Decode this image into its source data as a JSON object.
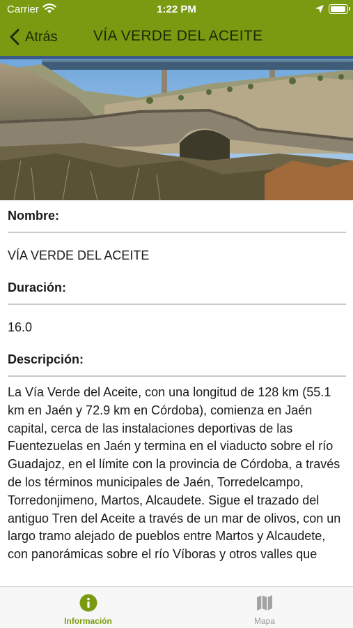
{
  "status_bar": {
    "carrier": "Carrier",
    "time": "1:22 PM"
  },
  "nav": {
    "back_label": "Atrás",
    "title": "VÍA VERDE DEL ACEITE"
  },
  "details": {
    "name_label": "Nombre:",
    "name_value": "VÍA VERDE DEL ACEITE",
    "duration_label": "Duración:",
    "duration_value": "16.0",
    "description_label": "Descripción:",
    "description_text": "La Vía Verde del Aceite, con una longitud de 128 km (55.1 km en Jaén y 72.9 km en Córdoba), comienza en Jaén capital, cerca de las instalaciones deportivas de las Fuentezuelas en Jaén y termina en el viaducto sobre el río Guadajoz, en el límite con la provincia de Córdoba, a través de los términos municipales de Jaén, Torredelcampo, Torredonjimeno, Martos, Alcaudete. Sigue el trazado del antiguo Tren del Aceite a través de un mar de olivos, con un largo tramo alejado de pueblos entre Martos y Alcaudete, con panorámicas sobre el río Víboras y otros valles que"
  },
  "tabs": [
    {
      "label": "Información",
      "icon": "info-icon",
      "active": true
    },
    {
      "label": "Mapa",
      "icon": "map-icon",
      "active": false
    }
  ],
  "colors": {
    "brand": "#7a9a12",
    "nav_text": "#1c2a05",
    "tab_inactive": "#999999"
  }
}
